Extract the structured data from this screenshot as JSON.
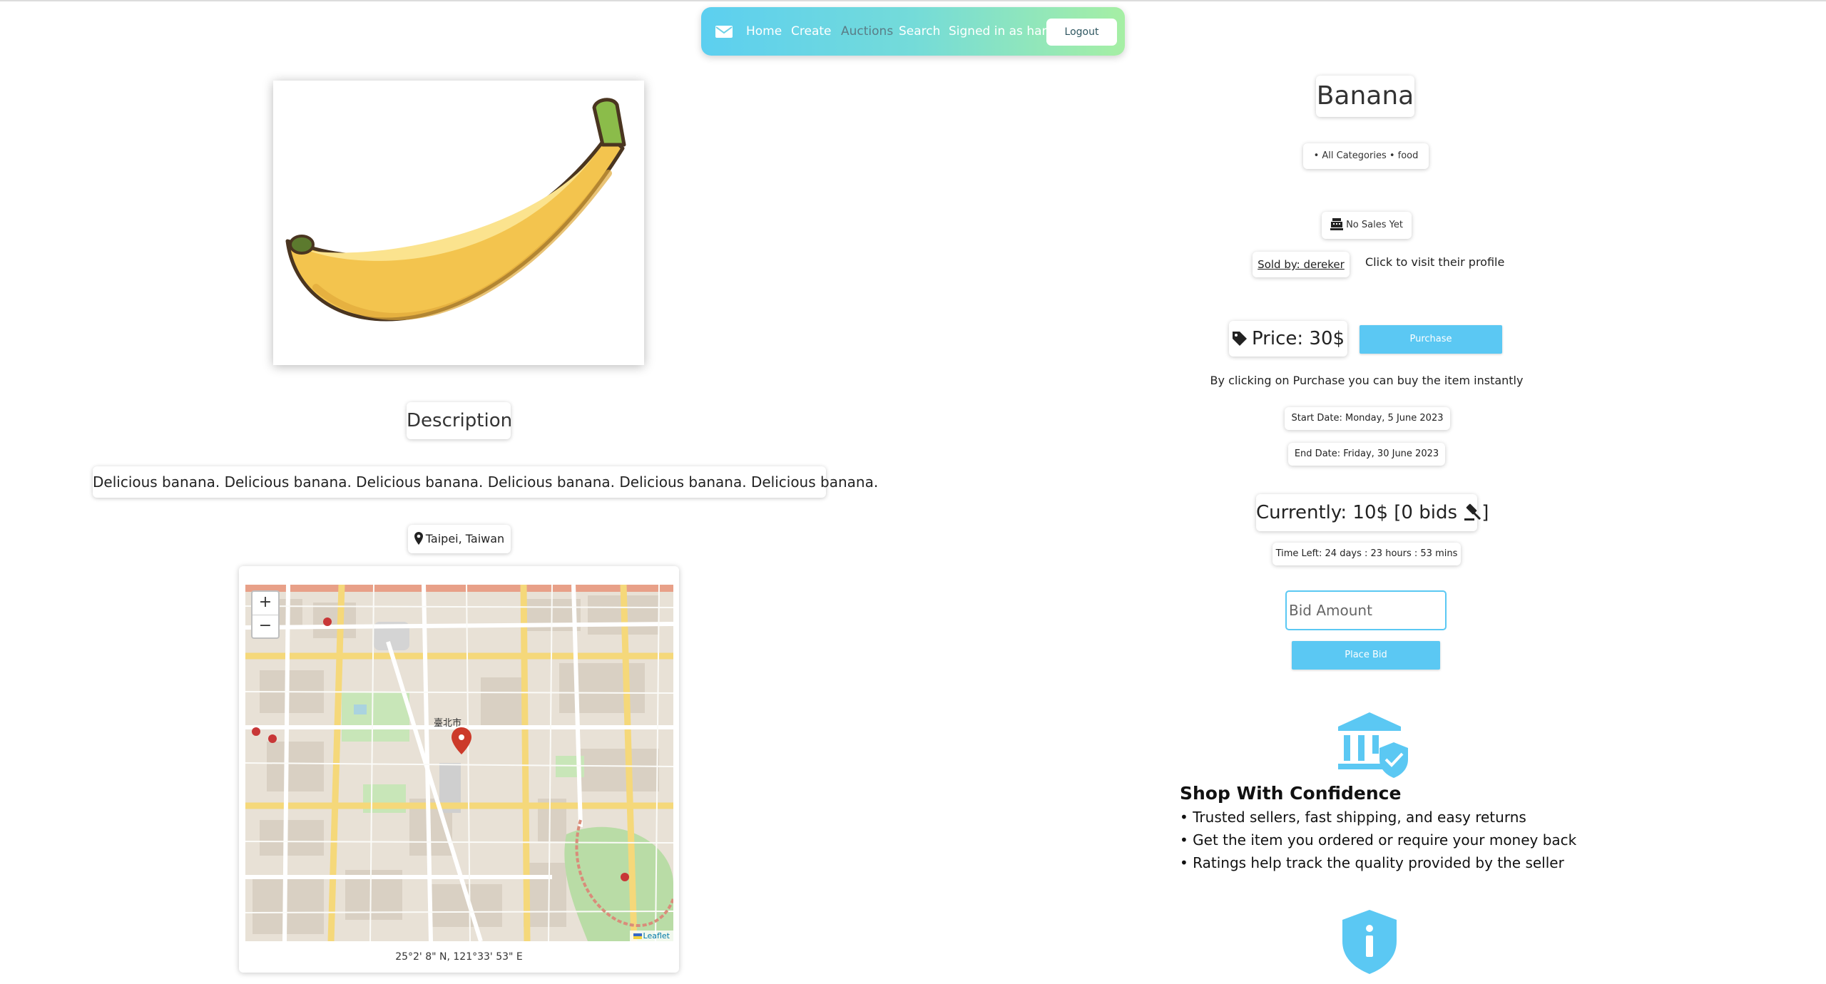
{
  "nav": {
    "home": "Home",
    "create": "Create",
    "auctions": "Auctions",
    "search": "Search",
    "signed_in": "Signed in as hans",
    "logout": "Logout"
  },
  "product": {
    "title": "Banana",
    "categories": "• All Categories  • food",
    "sales": "No Sales Yet",
    "seller": "Sold by: dereker",
    "profile_hint": "Click to visit their profile",
    "price": "Price: 30$",
    "purchase_label": "Purchase",
    "purchase_hint": "By clicking on Purchase you can buy the item instantly",
    "start_date": "Start Date: Monday, 5 June 2023",
    "end_date": "End Date: Friday, 30 June 2023",
    "current": "Currently: 10$ [0 bids",
    "time_left": "Time Left: 24 days : 23 hours : 53 mins",
    "bid_placeholder": "Bid Amount",
    "place_bid_label": "Place Bid"
  },
  "description": {
    "heading": "Description",
    "text": "Delicious banana. Delicious banana. Delicious banana. Delicious banana. Delicious banana. Delicious banana."
  },
  "location": {
    "label": "Taipei, Taiwan",
    "coords": "25°2' 8\" N, 121°33' 53\" E",
    "map_attribution": "Leaflet",
    "zoom_in": "+",
    "zoom_out": "−",
    "city_label": "臺北市"
  },
  "confidence": {
    "heading": "Shop With Confidence",
    "points": [
      "Trusted sellers, fast shipping, and easy returns",
      "Get the item you ordered or require your money back",
      "Ratings help track the quality provided by the seller"
    ]
  },
  "colors": {
    "accent": "#5bc8f3",
    "nav_gradient_start": "#5ccff0",
    "nav_gradient_end": "#a6efa4",
    "banana_yellow": "#f3c44e"
  },
  "icons": [
    "mail-icon",
    "map-pin-icon",
    "register-icon",
    "price-tag-icon",
    "gavel-icon",
    "bank-shield-icon",
    "info-shield-icon"
  ]
}
